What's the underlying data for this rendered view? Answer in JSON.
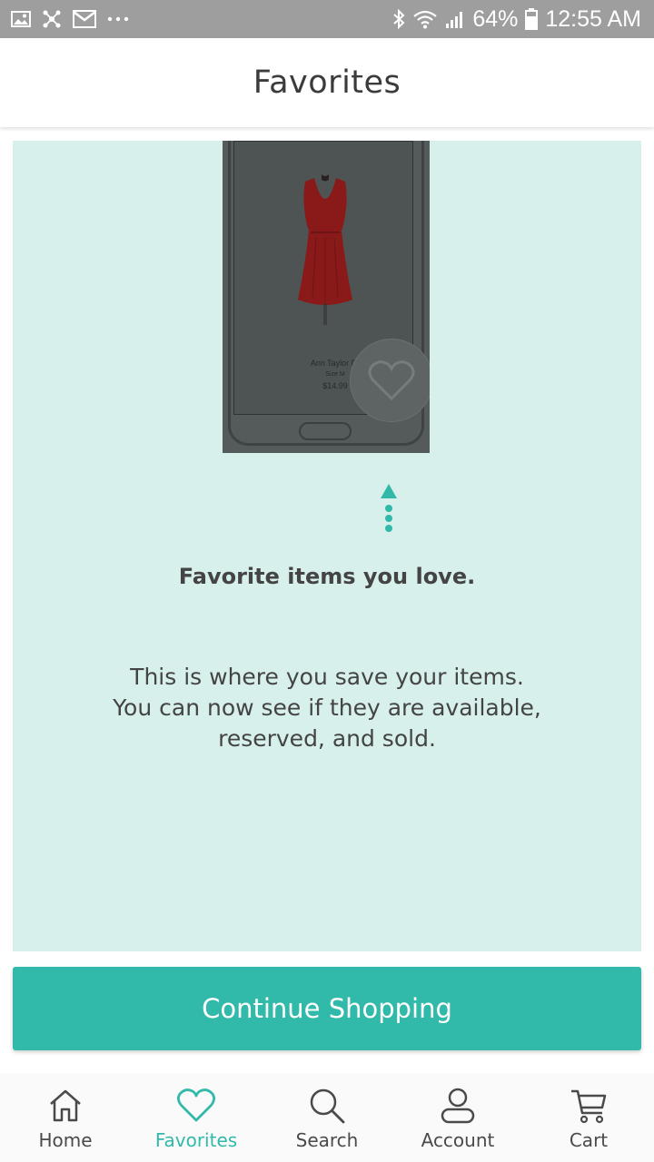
{
  "status_bar": {
    "battery": "64%",
    "time": "12:55 AM",
    "icons_left": [
      "image-icon",
      "network-icon",
      "gmail-icon",
      "more-dots-icon"
    ],
    "icons_right": [
      "bluetooth-icon",
      "wifi-icon",
      "signal-icon",
      "battery-icon"
    ]
  },
  "header": {
    "title": "Favorites"
  },
  "onboarding": {
    "illustration": {
      "item_name": "Ann Taylor Dr",
      "item_size": "Size M",
      "item_price": "$14.99"
    },
    "title": "Favorite items you love.",
    "description": "This is where you save your items. You can now see if they are available, reserved, and sold."
  },
  "continue_button": {
    "label": "Continue Shopping"
  },
  "bottom_nav": {
    "items": [
      {
        "label": "Home",
        "icon": "home-icon",
        "active": false
      },
      {
        "label": "Favorites",
        "icon": "heart-icon",
        "active": true
      },
      {
        "label": "Search",
        "icon": "search-icon",
        "active": false
      },
      {
        "label": "Account",
        "icon": "account-icon",
        "active": false
      },
      {
        "label": "Cart",
        "icon": "cart-icon",
        "active": false
      }
    ]
  },
  "colors": {
    "accent": "#31b9aa",
    "panel_bg": "#d7f0ec",
    "status_bar": "#9e9e9e",
    "text": "#444444"
  }
}
